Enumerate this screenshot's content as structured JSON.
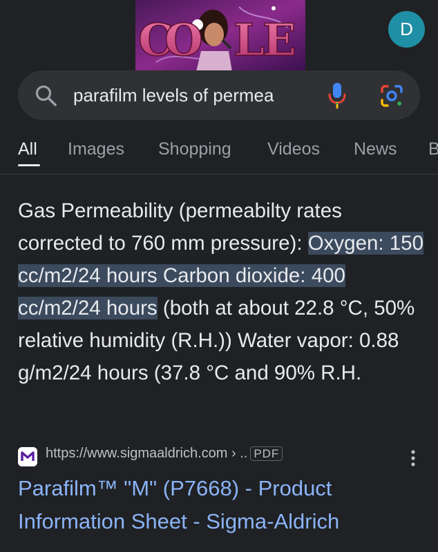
{
  "header": {
    "doodle_text": "GOOGLE",
    "avatar_letter": "D"
  },
  "search": {
    "query": "parafilm levels of permea"
  },
  "tabs": [
    {
      "label": "All",
      "active": true
    },
    {
      "label": "Images"
    },
    {
      "label": "Shopping"
    },
    {
      "label": "Videos"
    },
    {
      "label": "News"
    },
    {
      "label": "B"
    }
  ],
  "snippet": {
    "intro": "Gas Permeability (permeabilty rates corrected to 760 mm pressure): ",
    "highlight": "Oxygen: 150 cc/m2/24 hours Carbon dioxide: 400 cc/m2/24 hours",
    "rest": " (both at about 22.8 °C, 50% relative humidity (R.H.)) Water vapor: 0.88 g/m2/24 hours (37.8 °C and 90% R.H."
  },
  "result": {
    "favicon_letter": "M",
    "url": "https://www.sigmaaldrich.com › ..",
    "file_type": "PDF",
    "title": "Parafilm™ \"M\" (P7668) - Product Information Sheet - Sigma-Aldrich"
  },
  "colors": {
    "background": "#202124",
    "link": "#8ab4f8",
    "highlight": "#3c4a5e",
    "avatar": "#1f8fa5"
  }
}
